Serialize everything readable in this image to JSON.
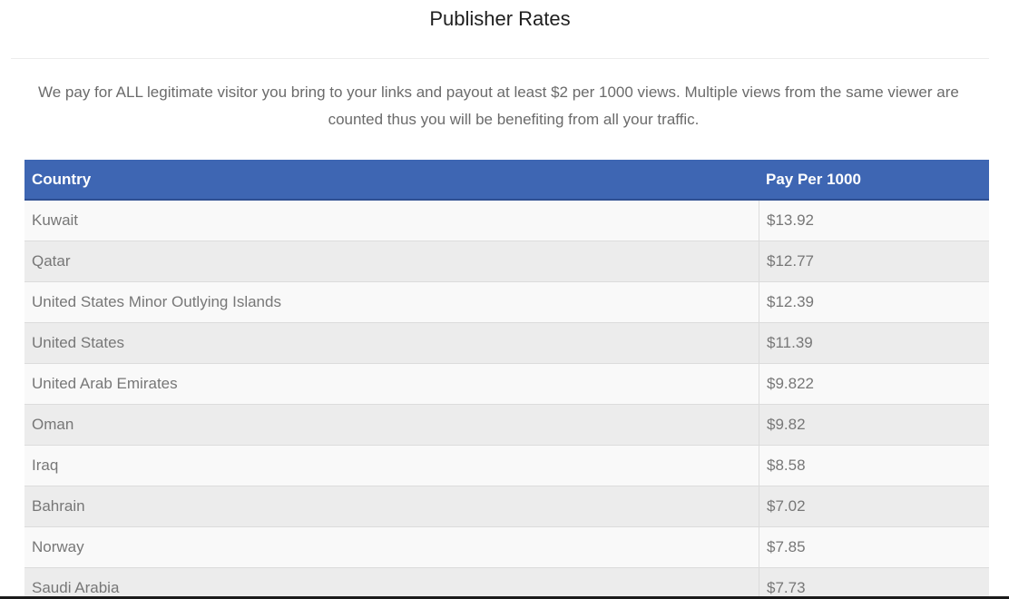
{
  "page": {
    "title": "Publisher Rates",
    "intro_line_1": "We pay for ALL legitimate visitor you bring to your links and payout at least $2 per 1000 views. Multiple views from the same viewer are",
    "intro_line_2": "counted thus you will be benefiting from all your traffic."
  },
  "table": {
    "headers": {
      "country": "Country",
      "pay": "Pay Per 1000"
    },
    "rows": [
      {
        "country": "Kuwait",
        "pay": "$13.92"
      },
      {
        "country": "Qatar",
        "pay": "$12.77"
      },
      {
        "country": "United States Minor Outlying Islands",
        "pay": "$12.39"
      },
      {
        "country": "United States",
        "pay": "$11.39"
      },
      {
        "country": "United Arab Emirates",
        "pay": "$9.822"
      },
      {
        "country": "Oman",
        "pay": "$9.82"
      },
      {
        "country": "Iraq",
        "pay": "$8.58"
      },
      {
        "country": "Bahrain",
        "pay": "$7.02"
      },
      {
        "country": "Norway",
        "pay": "$7.85"
      },
      {
        "country": "Saudi Arabia",
        "pay": "$7.73"
      }
    ]
  }
}
